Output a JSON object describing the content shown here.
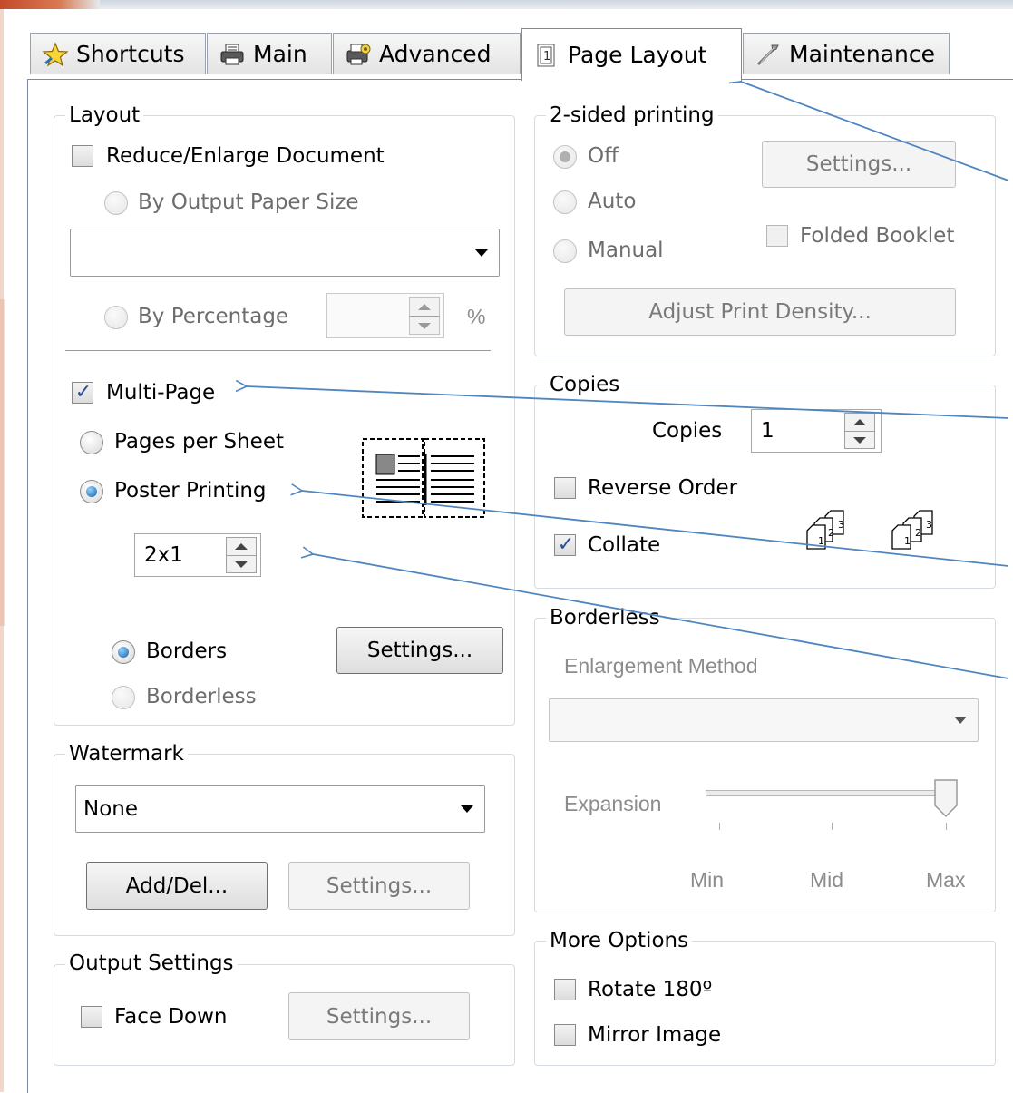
{
  "tabs": [
    {
      "label": "Shortcuts",
      "icon": "star-icon"
    },
    {
      "label": "Main",
      "icon": "printer-icon"
    },
    {
      "label": "Advanced",
      "icon": "advanced-settings-icon"
    },
    {
      "label": "Page Layout",
      "icon": "page-layout-icon",
      "active": true
    },
    {
      "label": "Maintenance",
      "icon": "wrench-icon"
    }
  ],
  "layout": {
    "title": "Layout",
    "reduce_enlarge_label": "Reduce/Enlarge Document",
    "reduce_enlarge_checked": false,
    "by_output_paper_size_label": "By Output Paper Size",
    "paper_size_value": "",
    "by_percentage_label": "By Percentage",
    "percentage_value": "",
    "percent_unit": "%",
    "multi_page_label": "Multi-Page",
    "multi_page_checked": true,
    "pages_per_sheet_label": "Pages per Sheet",
    "poster_printing_label": "Poster Printing",
    "poster_selected": true,
    "poster_value": "2x1",
    "borders_label": "Borders",
    "borderless_label": "Borderless",
    "settings_button": "Settings..."
  },
  "watermark": {
    "title": "Watermark",
    "selected": "None",
    "add_del_button": "Add/Del...",
    "settings_button": "Settings..."
  },
  "output_settings": {
    "title": "Output Settings",
    "face_down_label": "Face Down",
    "face_down_checked": false,
    "settings_button": "Settings..."
  },
  "two_sided": {
    "title": "2-sided printing",
    "off_label": "Off",
    "auto_label": "Auto",
    "manual_label": "Manual",
    "selected": "Off",
    "settings_button": "Settings...",
    "folded_booklet_label": "Folded Booklet",
    "adjust_density_button": "Adjust Print Density..."
  },
  "copies": {
    "title": "Copies",
    "copies_label": "Copies",
    "copies_value": "1",
    "reverse_order_label": "Reverse Order",
    "reverse_order_checked": false,
    "collate_label": "Collate",
    "collate_checked": true,
    "collate_icon_digits": [
      "1",
      "2",
      "3"
    ]
  },
  "borderless": {
    "title": "Borderless",
    "enlargement_method_label": "Enlargement Method",
    "enlargement_method_value": "",
    "expansion_label": "Expansion",
    "expansion_level": "Max",
    "scale_min": "Min",
    "scale_mid": "Mid",
    "scale_max": "Max"
  },
  "more_options": {
    "title": "More Options",
    "rotate_label": "Rotate 180º",
    "rotate_checked": false,
    "mirror_label": "Mirror Image",
    "mirror_checked": false
  },
  "colors": {
    "annotation_arrow": "#4f86c0",
    "tab_border": "#7e8a99",
    "group_border": "#d5dbe3",
    "radio_selected": "#1b5fa8",
    "check_mark": "#2c4d96"
  }
}
